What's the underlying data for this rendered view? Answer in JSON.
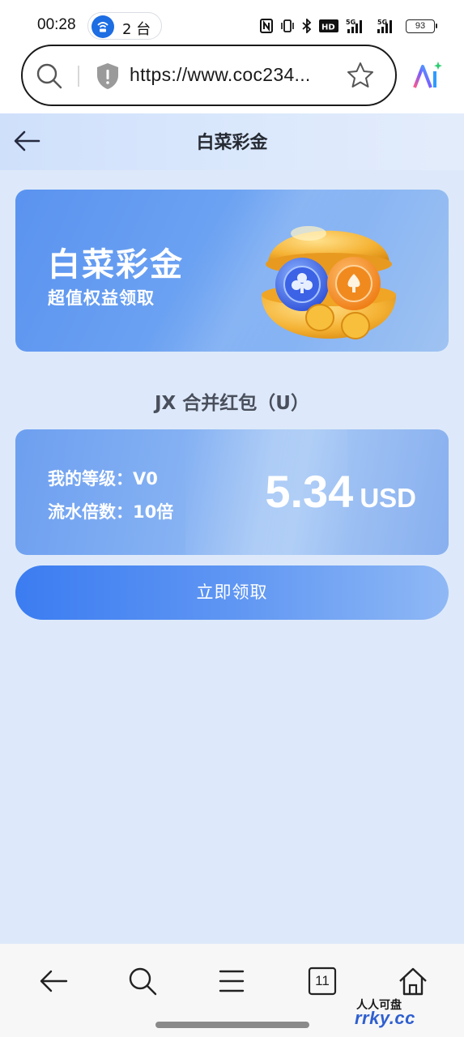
{
  "status_bar": {
    "time": "00:28",
    "hotspot_count": "2 台",
    "battery": "93",
    "network_1": "5G",
    "network_2": "5G"
  },
  "browser": {
    "url": "https://www.coc234...",
    "tab_count": "11"
  },
  "page": {
    "title": "白菜彩金"
  },
  "banner": {
    "title": "白菜彩金",
    "subtitle": "超值权益领取"
  },
  "section": {
    "title": "JX 合并红包（U）"
  },
  "info_card": {
    "level_text": "我的等级：V0",
    "turnover_text": "流水倍数：10倍",
    "amount": "5.34",
    "currency": "USD"
  },
  "claim_button": {
    "label": "立即领取"
  },
  "watermark": {
    "top": "人人可盘",
    "bottom": "rrky.cc"
  },
  "colors": {
    "accent": "#3b7cf1",
    "page_background": "#dde9fa",
    "banner": "#6da3f2"
  }
}
